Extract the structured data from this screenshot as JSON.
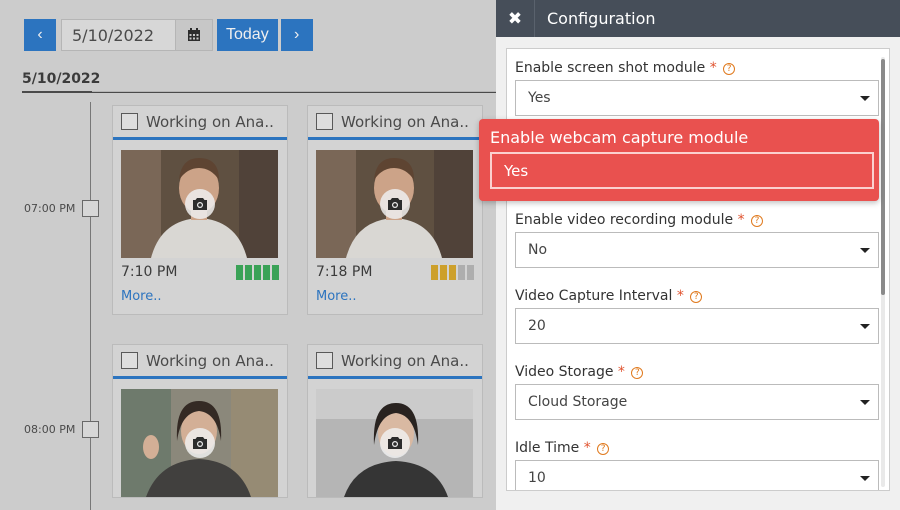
{
  "toolbar": {
    "prev_icon": "chevron-left-icon",
    "prev_glyph": "‹",
    "date_value": "5/10/2022",
    "calendar_icon": "calendar-icon",
    "today_label": "Today",
    "next_icon": "chevron-right-icon",
    "next_glyph": "›"
  },
  "timeline": {
    "date_heading": "5/10/2022",
    "times": [
      "07:00 PM",
      "08:00 PM"
    ]
  },
  "cards": [
    {
      "title": "Working on Ana..",
      "time": "7:10 PM",
      "activity_level": 5,
      "activity_color": "#32a852",
      "more_label": "More.."
    },
    {
      "title": "Working on Ana..",
      "time": "7:18 PM",
      "activity_level": 3,
      "activity_color": "#d9a520",
      "more_label": "More.."
    },
    {
      "title": "Working on Ana..",
      "time": "",
      "activity_level": 0,
      "activity_color": "",
      "more_label": ""
    },
    {
      "title": "Working on Ana..",
      "time": "",
      "activity_level": 0,
      "activity_color": "",
      "more_label": ""
    }
  ],
  "panel": {
    "close_icon": "close-icon",
    "close_glyph": "✖",
    "title": "Configuration",
    "required_mark": "*",
    "help_glyph": "?",
    "fields": [
      {
        "label": "Enable screen shot module",
        "value": "Yes"
      },
      {
        "label": "Enable video recording module",
        "value": "No"
      },
      {
        "label": "Video Capture Interval",
        "value": "20"
      },
      {
        "label": "Video Storage",
        "value": "Cloud Storage"
      },
      {
        "label": "Idle Time",
        "value": "10"
      }
    ]
  },
  "highlight": {
    "label": "Enable webcam capture module",
    "value": "Yes"
  },
  "colors": {
    "accent": "#2273c9",
    "panel_header": "#464e59",
    "highlight": "#e9514f",
    "required": "#e0522e",
    "help": "#e07a1e"
  }
}
